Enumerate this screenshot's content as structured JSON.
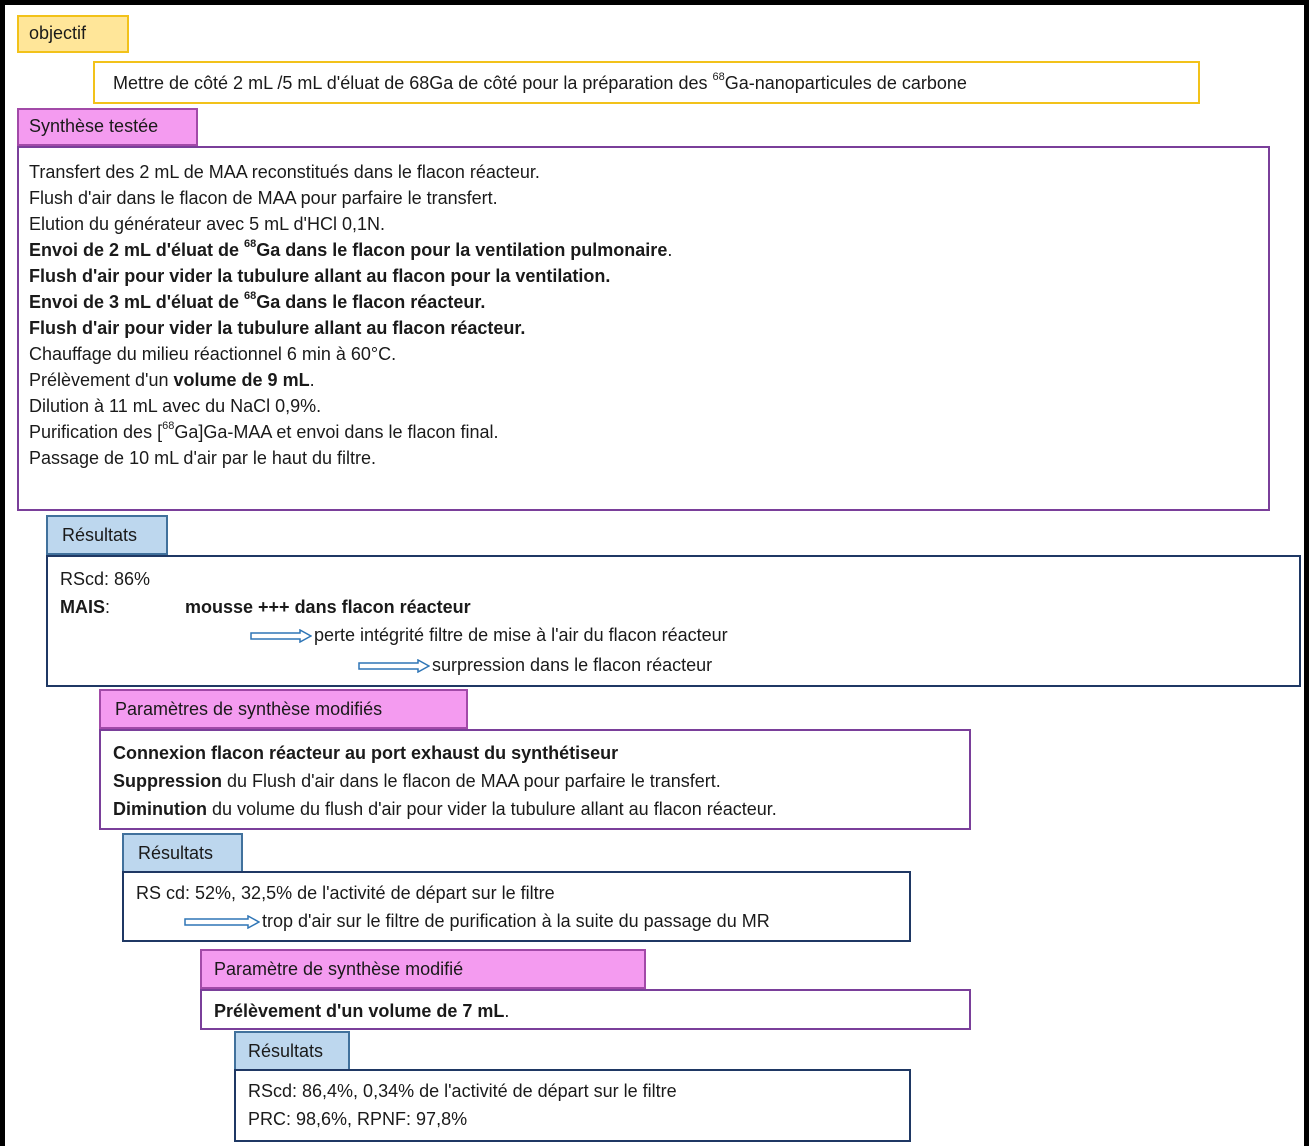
{
  "objectif": {
    "label": "objectif",
    "text_pre": "Mettre de côté 2 mL /5 mL d'éluat de 68Ga de côté pour la préparation des ",
    "text_sup": "68",
    "text_post": "Ga-nanoparticules de carbone"
  },
  "synthese": {
    "label": "Synthèse testée",
    "l1": "Transfert des 2 mL de MAA reconstitués dans le flacon réacteur.",
    "l2": "Flush d'air dans le flacon de MAA pour parfaire le transfert.",
    "l3": "Elution du générateur avec 5 mL d'HCl 0,1N.",
    "l4_pre": "Envoi de 2 mL d'éluat de ",
    "l4_sup": "68",
    "l4_post": "Ga dans le flacon pour la ventilation pulmonaire",
    "l4_end": ".",
    "l5": "Flush d'air pour vider la tubulure allant au flacon pour la ventilation.",
    "l6_pre": "Envoi de 3 mL d'éluat de ",
    "l6_sup": "68",
    "l6_post": "Ga dans le flacon réacteur.",
    "l7": "Flush d'air pour vider la tubulure allant au flacon réacteur.",
    "l8": "Chauffage du milieu réactionnel 6 min à 60°C.",
    "l9_pre": "Prélèvement d'un ",
    "l9_bold": "volume de 9 mL",
    "l9_end": ".",
    "l10": "Dilution à 11 mL avec du NaCl 0,9%.",
    "l11_pre": "Purification des [",
    "l11_sup": "68",
    "l11_post": "Ga]Ga-MAA et envoi dans le flacon final.",
    "l12": "Passage de 10 mL d'air par le haut du filtre."
  },
  "resultats1": {
    "label": "Résultats",
    "l1": "RScd: 86%",
    "mais": "MAIS",
    "colon": ":",
    "mousse": "mousse +++ dans flacon réacteur",
    "arrow1": "perte intégrité filtre de mise à l'air du flacon réacteur",
    "arrow2": "surpression dans le flacon réacteur"
  },
  "params1": {
    "label": "Paramètres de synthèse modifiés",
    "l1": "Connexion flacon réacteur au port exhaust du synthétiseur",
    "l2_bold": "Suppression",
    "l2_rest": " du Flush d'air dans le flacon de MAA pour parfaire le transfert.",
    "l3_bold": "Diminution",
    "l3_rest": " du volume du flush d'air pour vider la tubulure allant au flacon réacteur."
  },
  "resultats2": {
    "label": "Résultats",
    "l1": "RS cd: 52%, 32,5% de l'activité de départ sur le filtre",
    "arrow": "trop d'air sur le filtre de purification à la suite du passage du MR"
  },
  "params2": {
    "label": "Paramètre de synthèse modifié",
    "l1_bold": "Prélèvement d'un volume de 7 mL",
    "l1_end": "."
  },
  "resultats3": {
    "label": "Résultats",
    "l1": "RScd: 86,4%, 0,34% de l'activité de départ sur le filtre",
    "l2": "PRC: 98,6%, RPNF: 97,8%"
  },
  "colors": {
    "yellow_fill": "#ffe699",
    "pink_fill": "#f49bf0",
    "blue_fill": "#bdd7ee",
    "arrow": "#2e75b6"
  }
}
